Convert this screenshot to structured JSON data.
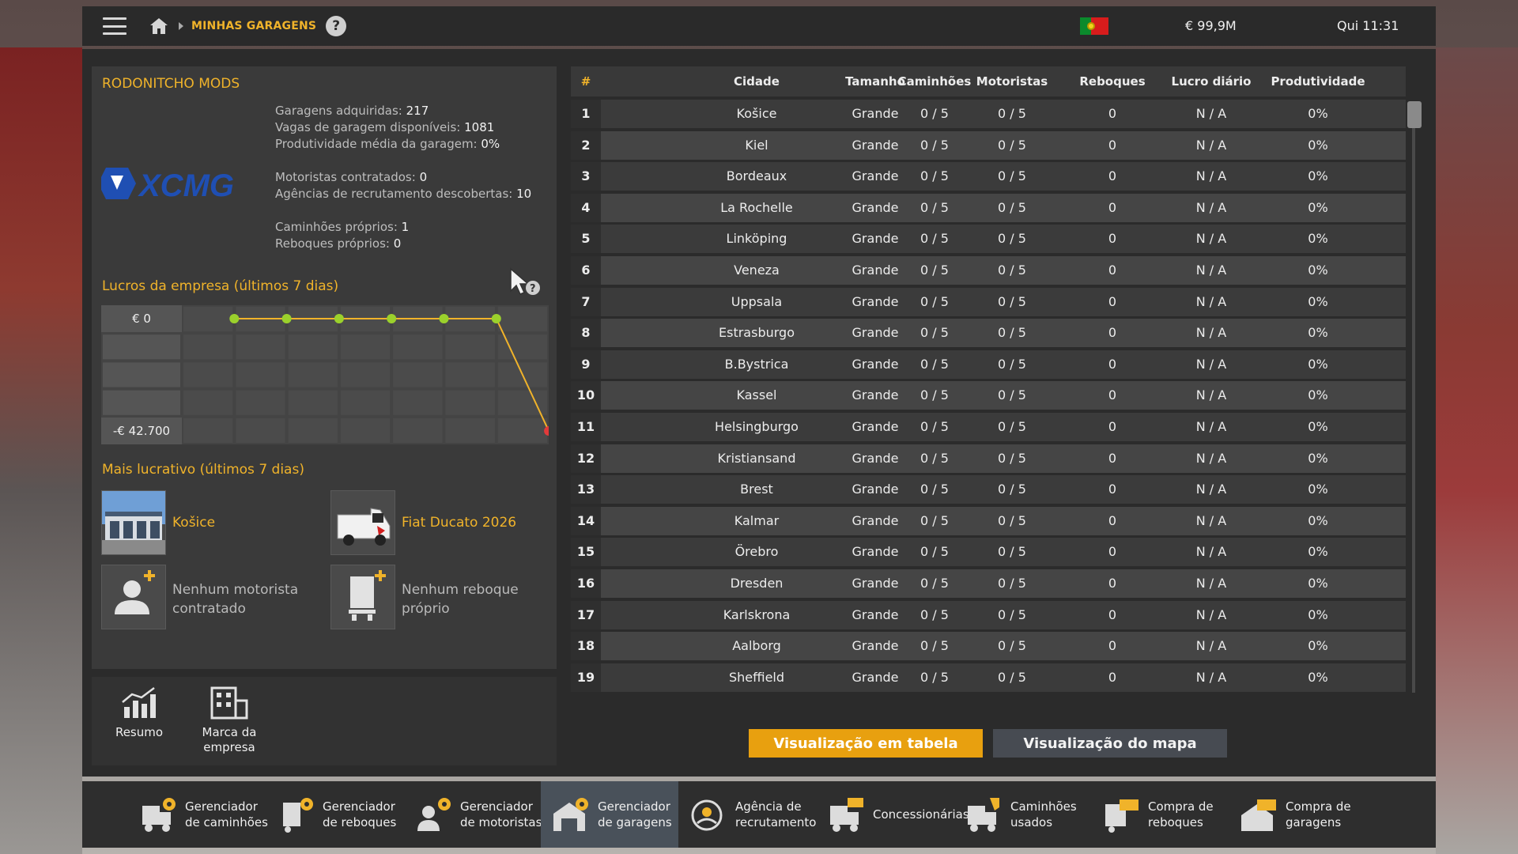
{
  "topbar": {
    "breadcrumb": "MINHAS GARAGENS",
    "help": "?",
    "money": "€ 99,9M",
    "clock": "Qui 11:31"
  },
  "company": {
    "name": "RODONITCHO MODS",
    "logo_text": "XCMG",
    "stats": {
      "garages_label": "Garagens adquiridas:",
      "garages": "217",
      "slots_label": "Vagas de garagem disponíveis:",
      "slots": "1081",
      "productivity_label": "Produtividade média da garagem:",
      "productivity": "0%",
      "drivers_label": "Motoristas contratados:",
      "drivers": "0",
      "agencies_label": "Agências de recrutamento descobertas:",
      "agencies": "10",
      "trucks_label": "Caminhões próprios:",
      "trucks": "1",
      "trailers_label": "Reboques próprios:",
      "trailers": "0"
    }
  },
  "profit": {
    "title": "Lucros da empresa (últimos 7 dias)",
    "max_label": "€ 0",
    "min_label": "-€ 42.700"
  },
  "chart_data": {
    "type": "line",
    "title": "Lucros da empresa (últimos 7 dias)",
    "x": [
      1,
      2,
      3,
      4,
      5,
      6,
      7
    ],
    "values": [
      0,
      0,
      0,
      0,
      0,
      0,
      -42700
    ],
    "ylim": [
      -42700,
      0
    ],
    "ytick_labels": [
      "€ 0",
      "-€ 42.700"
    ],
    "grid": true,
    "colors": {
      "line": "#f0b32a",
      "point": "#9bd12c",
      "last_point": "#e23a3a"
    }
  },
  "most_profitable": {
    "title": "Mais lucrativo (últimos 7 dias)",
    "garage": "Košice",
    "truck": "Fiat Ducato 2026",
    "driver": "Nenhum motorista contratado",
    "trailer": "Nenhum reboque próprio"
  },
  "left_nav": {
    "summary": "Resumo",
    "brand": "Marca da empresa"
  },
  "table": {
    "headers": [
      "#",
      "Cidade",
      "Tamanho",
      "Caminhões",
      "Motoristas",
      "Reboques",
      "Lucro diário",
      "Produtividade"
    ],
    "rows": [
      [
        "1",
        "Košice",
        "Grande",
        "0 / 5",
        "0 / 5",
        "0",
        "N / A",
        "0%"
      ],
      [
        "2",
        "Kiel",
        "Grande",
        "0 / 5",
        "0 / 5",
        "0",
        "N / A",
        "0%"
      ],
      [
        "3",
        "Bordeaux",
        "Grande",
        "0 / 5",
        "0 / 5",
        "0",
        "N / A",
        "0%"
      ],
      [
        "4",
        "La Rochelle",
        "Grande",
        "0 / 5",
        "0 / 5",
        "0",
        "N / A",
        "0%"
      ],
      [
        "5",
        "Linköping",
        "Grande",
        "0 / 5",
        "0 / 5",
        "0",
        "N / A",
        "0%"
      ],
      [
        "6",
        "Veneza",
        "Grande",
        "0 / 5",
        "0 / 5",
        "0",
        "N / A",
        "0%"
      ],
      [
        "7",
        "Uppsala",
        "Grande",
        "0 / 5",
        "0 / 5",
        "0",
        "N / A",
        "0%"
      ],
      [
        "8",
        "Estrasburgo",
        "Grande",
        "0 / 5",
        "0 / 5",
        "0",
        "N / A",
        "0%"
      ],
      [
        "9",
        "B.Bystrica",
        "Grande",
        "0 / 5",
        "0 / 5",
        "0",
        "N / A",
        "0%"
      ],
      [
        "10",
        "Kassel",
        "Grande",
        "0 / 5",
        "0 / 5",
        "0",
        "N / A",
        "0%"
      ],
      [
        "11",
        "Helsingburgo",
        "Grande",
        "0 / 5",
        "0 / 5",
        "0",
        "N / A",
        "0%"
      ],
      [
        "12",
        "Kristiansand",
        "Grande",
        "0 / 5",
        "0 / 5",
        "0",
        "N / A",
        "0%"
      ],
      [
        "13",
        "Brest",
        "Grande",
        "0 / 5",
        "0 / 5",
        "0",
        "N / A",
        "0%"
      ],
      [
        "14",
        "Kalmar",
        "Grande",
        "0 / 5",
        "0 / 5",
        "0",
        "N / A",
        "0%"
      ],
      [
        "15",
        "Örebro",
        "Grande",
        "0 / 5",
        "0 / 5",
        "0",
        "N / A",
        "0%"
      ],
      [
        "16",
        "Dresden",
        "Grande",
        "0 / 5",
        "0 / 5",
        "0",
        "N / A",
        "0%"
      ],
      [
        "17",
        "Karlskrona",
        "Grande",
        "0 / 5",
        "0 / 5",
        "0",
        "N / A",
        "0%"
      ],
      [
        "18",
        "Aalborg",
        "Grande",
        "0 / 5",
        "0 / 5",
        "0",
        "N / A",
        "0%"
      ],
      [
        "19",
        "Sheffield",
        "Grande",
        "0 / 5",
        "0 / 5",
        "0",
        "N / A",
        "0%"
      ]
    ]
  },
  "view_buttons": {
    "table": "Visualização em tabela",
    "map": "Visualização do mapa"
  },
  "nav": [
    {
      "label": "Gerenciador de caminhões",
      "icon": "truck-manager-icon",
      "active": false
    },
    {
      "label": "Gerenciador de reboques",
      "icon": "trailer-manager-icon",
      "active": false
    },
    {
      "label": "Gerenciador de motoristas",
      "icon": "driver-manager-icon",
      "active": false
    },
    {
      "label": "Gerenciador de garagens",
      "icon": "garage-manager-icon",
      "active": true
    },
    {
      "label": "Agência de recrutamento",
      "icon": "recruitment-agency-icon",
      "active": false
    },
    {
      "label": "Concessionárias",
      "icon": "dealership-icon",
      "active": false
    },
    {
      "label": "Caminhões usados",
      "icon": "used-trucks-icon",
      "active": false
    },
    {
      "label": "Compra de reboques",
      "icon": "trailer-purchase-icon",
      "active": false
    },
    {
      "label": "Compra de garagens",
      "icon": "garage-purchase-icon",
      "active": false
    }
  ],
  "colors": {
    "accent": "#f0b32a",
    "active_button": "#e8a00f"
  }
}
